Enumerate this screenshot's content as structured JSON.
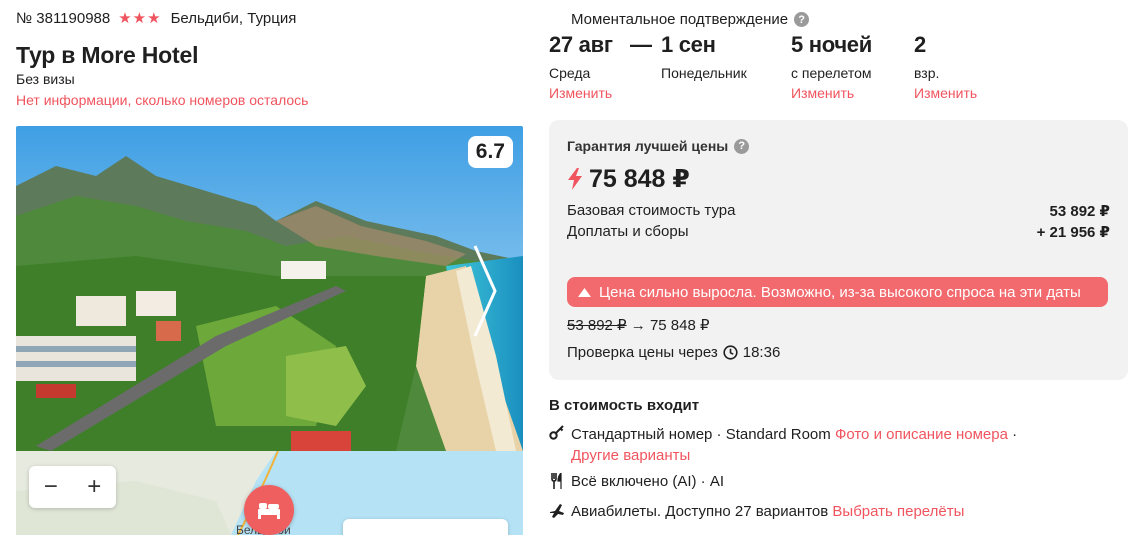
{
  "tour": {
    "id": "№ 381190988",
    "stars": "★★★",
    "location": "Бельдиби, Турция",
    "title": "Тур в More Hotel",
    "visa": "Без визы",
    "rooms_info": "Нет информации, сколько номеров осталось"
  },
  "gallery": {
    "rating": "6.7"
  },
  "map": {
    "zoom_out": "−",
    "zoom_in": "+",
    "town_label": "Бельдиби"
  },
  "booking": {
    "instant_confirmation": "Моментальное подтверждение",
    "help_glyph": "?",
    "dash": "—",
    "date_from": "27 авг",
    "date_from_day": "Среда",
    "date_to": "1 сен",
    "date_to_day": "Понедельник",
    "nights": "5 ночей",
    "nights_note": "с перелетом",
    "adults": "2",
    "adults_note": "взр.",
    "change_label": "Изменить"
  },
  "price": {
    "guarantee": "Гарантия лучшей цены",
    "total": "75 848 ₽",
    "base_label": "Базовая стоимость тура",
    "base_value": "53 892 ₽",
    "fees_label": "Доплаты и сборы",
    "fees_value": "+ 21 956 ₽",
    "alert": "Цена сильно выросла. Возможно, из-за высокого спроса на эти даты",
    "old_price": "53 892 ₽",
    "arrow": "→",
    "new_price": "75 848 ₽",
    "check_label": "Проверка цены через",
    "check_time": "18:36"
  },
  "included": {
    "title": "В стоимость входит",
    "room": "Стандартный номер · Standard Room",
    "room_link": "Фото и описание номера",
    "separator": "·",
    "other_variants": "Другие варианты",
    "meal": "Всё включено (AI) · AI",
    "flights": "Авиабилеты. Доступно 27 вариантов",
    "flights_link": "Выбрать перелёты"
  },
  "colors": {
    "accent": "#f0545e",
    "alert_bg": "#f26a6e",
    "panel_bg": "#f2f2f2"
  }
}
